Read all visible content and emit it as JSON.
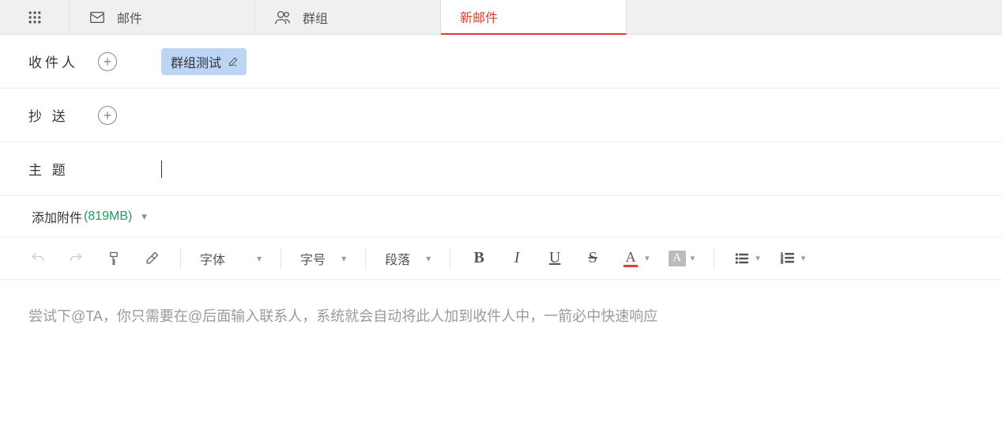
{
  "tabs": {
    "mail": {
      "label": "邮件"
    },
    "groups": {
      "label": "群组"
    },
    "compose": {
      "label": "新邮件"
    }
  },
  "compose": {
    "to_label": "收件人",
    "cc_label": "抄 送",
    "subject_label": "主 题",
    "recipient_chip": "群组测试",
    "subject_value": ""
  },
  "attachment": {
    "label": "添加附件",
    "size": "(819MB)"
  },
  "toolbar": {
    "font_label": "字体",
    "size_label": "字号",
    "para_label": "段落"
  },
  "body": {
    "placeholder": "尝试下@TA，你只需要在@后面输入联系人，系统就会自动将此人加到收件人中，一箭必中快速响应"
  }
}
